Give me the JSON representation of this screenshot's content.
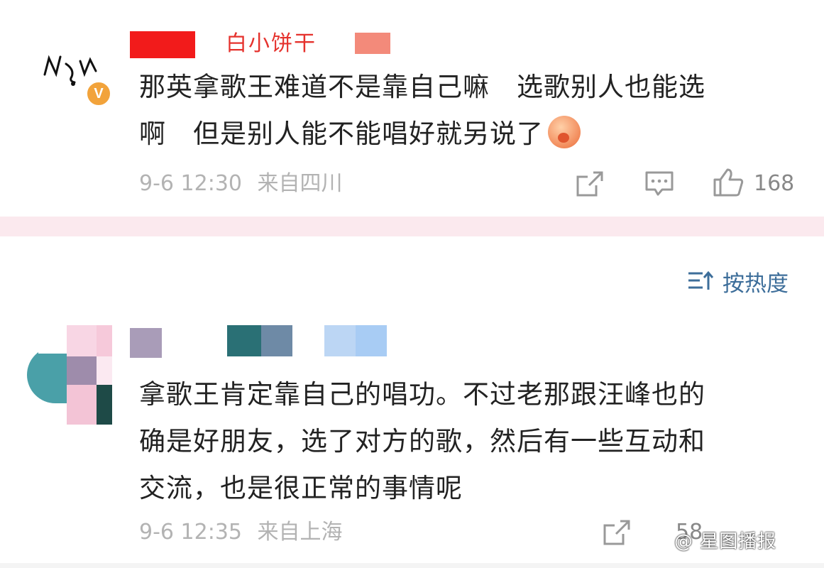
{
  "comments": [
    {
      "username_partial": "白小饼干",
      "badge": "V",
      "text_line1": "那英拿歌王难道不是靠自己嘛　选歌别人也能选",
      "text_line2": "啊　但是别人能不能唱好就另说了",
      "time": "9-6 12:30",
      "location": "来自四川",
      "likes": "168"
    },
    {
      "text_line1": "拿歌王肯定靠自己的唱功。不过老那跟汪峰也的",
      "text_line2": "确是好朋友，选了对方的歌，然后有一些互动和",
      "text_line3": "交流，也是很正常的事情呢",
      "time": "9-6 12:35",
      "location": "来自上海",
      "likes": "58"
    }
  ],
  "sort": {
    "label": "按热度"
  },
  "watermark": "@ 星图播报",
  "colors": {
    "accent_blue": "#3d6e9a",
    "divider_pink": "#fbe9ee",
    "meta_gray": "#b3b3b3",
    "badge_orange": "#f2a33b"
  },
  "icons": [
    "share-icon",
    "comment-icon",
    "like-icon",
    "sort-icon",
    "verified-badge"
  ]
}
